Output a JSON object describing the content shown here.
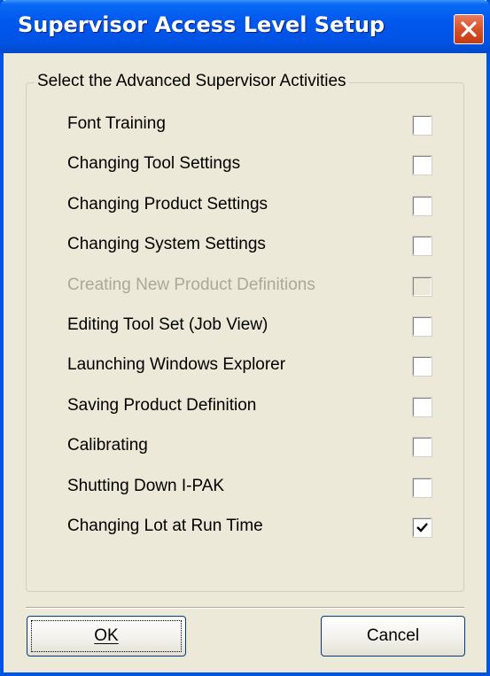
{
  "window": {
    "title": "Supervisor Access Level Setup",
    "close_icon": "close-icon",
    "accent_color": "#0054e3",
    "close_color": "#d8512a"
  },
  "group": {
    "label": "Select the Advanced Supervisor Activities"
  },
  "items": [
    {
      "label": "Font Training",
      "checked": false,
      "enabled": true
    },
    {
      "label": "Changing Tool Settings",
      "checked": false,
      "enabled": true
    },
    {
      "label": "Changing Product Settings",
      "checked": false,
      "enabled": true
    },
    {
      "label": "Changing System Settings",
      "checked": false,
      "enabled": true
    },
    {
      "label": "Creating New Product Definitions",
      "checked": false,
      "enabled": false
    },
    {
      "label": "Editing Tool Set (Job View)",
      "checked": false,
      "enabled": true
    },
    {
      "label": "Launching Windows Explorer",
      "checked": false,
      "enabled": true
    },
    {
      "label": "Saving Product Definition",
      "checked": false,
      "enabled": true
    },
    {
      "label": "Calibrating",
      "checked": false,
      "enabled": true
    },
    {
      "label": "Shutting Down I-PAK",
      "checked": false,
      "enabled": true
    },
    {
      "label": "Changing Lot at Run Time",
      "checked": true,
      "enabled": true
    }
  ],
  "buttons": {
    "ok_label": "OK",
    "cancel_label": "Cancel"
  }
}
